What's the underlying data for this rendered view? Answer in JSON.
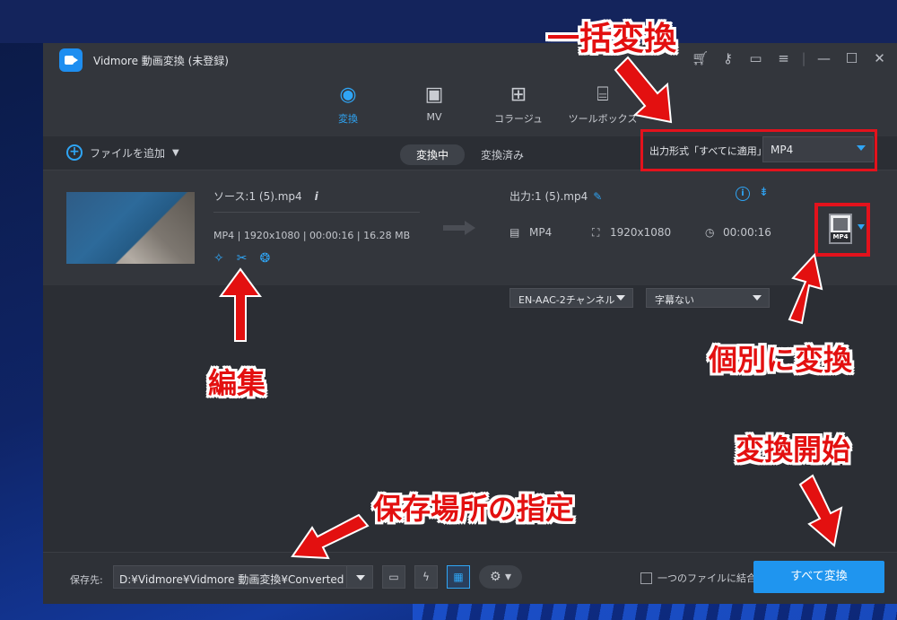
{
  "app": {
    "title": "Vidmore 動画変換 (未登録)"
  },
  "tabs": [
    {
      "label": "変換"
    },
    {
      "label": "MV"
    },
    {
      "label": "コラージュ"
    },
    {
      "label": "ツールボックス"
    }
  ],
  "toolbar": {
    "add_file": "ファイルを追加",
    "seg_converting": "変換中",
    "seg_converted": "変換済み",
    "output_format_label": "出力形式「すべてに適用」:",
    "output_format_value": "MP4"
  },
  "file": {
    "source": "ソース:1 (5).mp4",
    "meta": "MP4 | 1920x1080 | 00:00:16 | 16.28 MB",
    "output": "出力:1 (5).mp4",
    "out_format": "MP4",
    "out_res": "1920x1080",
    "out_duration": "00:00:16",
    "audio": "EN-AAC-2チャンネル",
    "subtitle": "字幕ない",
    "format_icon_label": "MP4"
  },
  "bottom": {
    "save_label": "保存先:",
    "save_path": "D:¥Vidmore¥Vidmore 動画変換¥Converted",
    "merge_label": "一つのファイルに結合",
    "convert_all": "すべて変換"
  },
  "annotations": {
    "batch": "一括変換",
    "edit": "編集",
    "individual": "個別に変換",
    "start": "変換開始",
    "save_location": "保存場所の指定"
  },
  "colors": {
    "accent": "#2fa5f5",
    "annotation": "#e31010",
    "convert_button": "#1f95ef"
  }
}
